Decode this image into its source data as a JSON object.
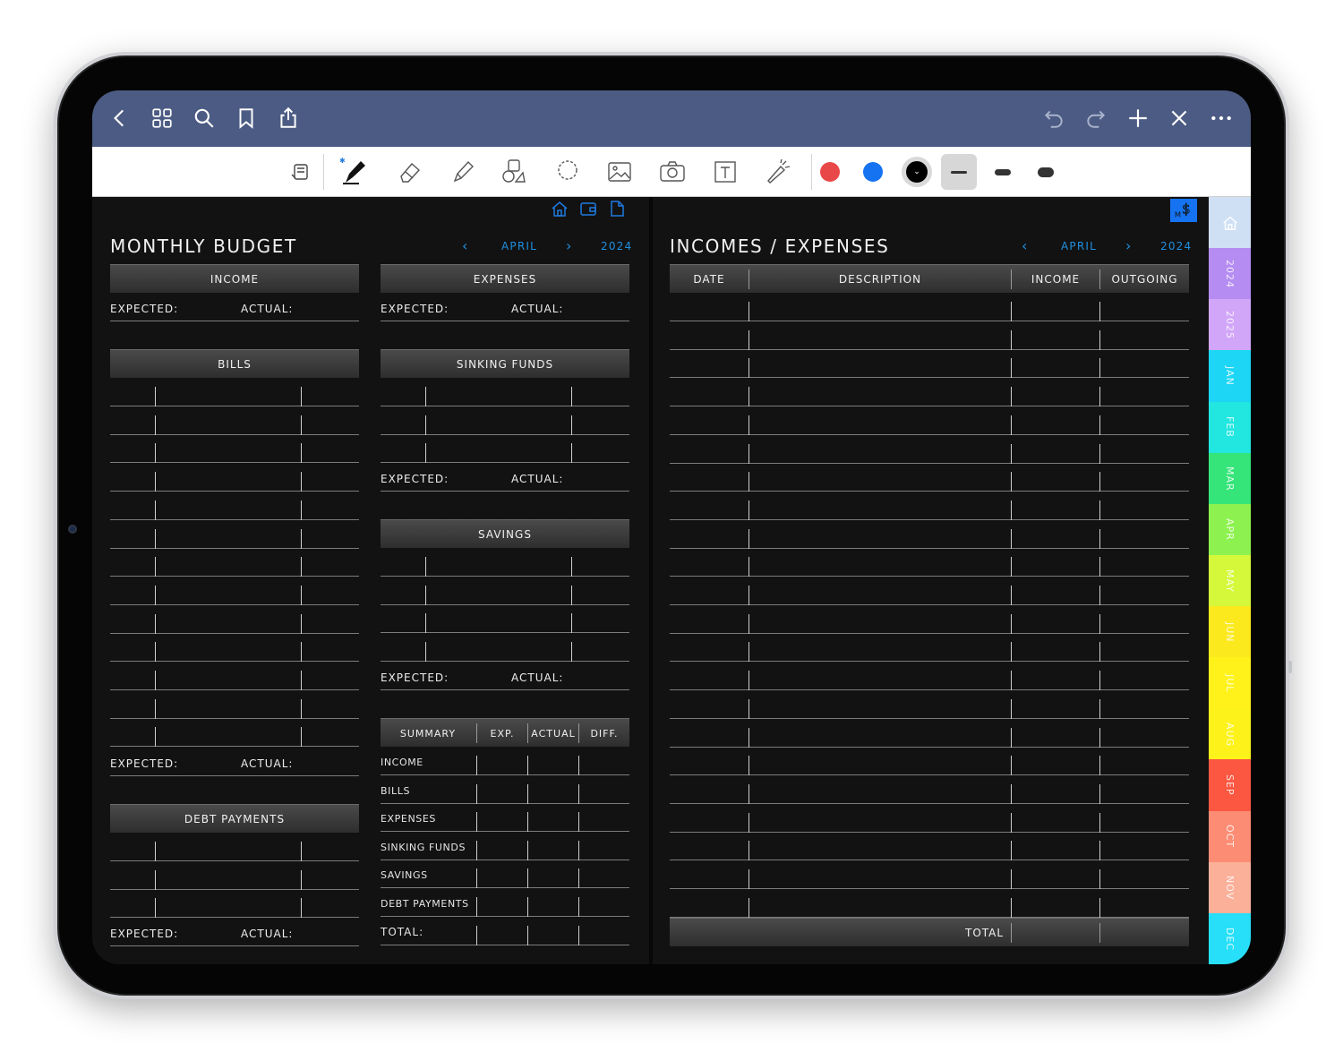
{
  "app": {
    "topbar": {
      "left_icons": [
        "back-chevron-icon",
        "grid-icon",
        "search-icon",
        "bookmark-icon",
        "share-icon"
      ],
      "right_icons": [
        "undo-icon",
        "redo-icon",
        "plus-icon",
        "close-tools-icon",
        "more-icon"
      ]
    },
    "toolbar": {
      "tools": [
        "toolbar-toggle-icon",
        "pen-icon",
        "eraser-icon",
        "highlighter-icon",
        "shapes-icon",
        "lasso-icon",
        "image-icon",
        "camera-icon",
        "text-icon",
        "laser-pointer-icon"
      ],
      "colors": [
        "#e94848",
        "#1573f2",
        "#000000"
      ],
      "stroke_widths": [
        "thin",
        "medium",
        "thick"
      ]
    }
  },
  "left_page": {
    "title": "MONTHLY BUDGET",
    "nav": {
      "prev": "‹",
      "month": "APRIL",
      "next": "›",
      "year": "2024"
    },
    "income": {
      "header": "INCOME",
      "expected": "EXPECTED:",
      "actual": "ACTUAL:"
    },
    "expenses": {
      "header": "EXPENSES",
      "expected": "EXPECTED:",
      "actual": "ACTUAL:"
    },
    "bills": {
      "header": "BILLS",
      "expected": "EXPECTED:",
      "actual": "ACTUAL:"
    },
    "sinking_funds": {
      "header": "SINKING FUNDS",
      "expected": "EXPECTED:",
      "actual": "ACTUAL:"
    },
    "savings": {
      "header": "SAVINGS",
      "expected": "EXPECTED:",
      "actual": "ACTUAL:"
    },
    "debt_payments": {
      "header": "DEBT PAYMENTS",
      "expected": "EXPECTED:",
      "actual": "ACTUAL:"
    },
    "summary": {
      "columns": [
        "SUMMARY",
        "EXP.",
        "ACTUAL",
        "DIFF."
      ],
      "rows": [
        "INCOME",
        "BILLS",
        "EXPENSES",
        "SINKING FUNDS",
        "SAVINGS",
        "DEBT PAYMENTS",
        "TOTAL:"
      ]
    }
  },
  "right_page": {
    "title": "INCOMES / EXPENSES",
    "nav": {
      "prev": "‹",
      "month": "APRIL",
      "next": "›",
      "year": "2024"
    },
    "columns": [
      "DATE",
      "DESCRIPTION",
      "INCOME",
      "OUTGOING"
    ],
    "total_label": "TOTAL"
  },
  "side_tabs": [
    {
      "label": "",
      "icon": "home-icon",
      "color": "#cfe0f5"
    },
    {
      "label": "2024",
      "color": "#b58cf2"
    },
    {
      "label": "2025",
      "color": "#d1a6f8"
    },
    {
      "label": "JAN",
      "color": "#1dd6f5"
    },
    {
      "label": "FEB",
      "color": "#22e6e0"
    },
    {
      "label": "MAR",
      "color": "#36e57a"
    },
    {
      "label": "APR",
      "color": "#8df24f"
    },
    {
      "label": "MAY",
      "color": "#d5f83a"
    },
    {
      "label": "JUN",
      "color": "#fbe91d"
    },
    {
      "label": "JUL",
      "color": "#fff21a"
    },
    {
      "label": "AUG",
      "color": "#fdf21a"
    },
    {
      "label": "SEP",
      "color": "#fb5741"
    },
    {
      "label": "OCT",
      "color": "#fd8c74"
    },
    {
      "label": "NOV",
      "color": "#fbb09a"
    },
    {
      "label": "DEC",
      "color": "#27dff8"
    }
  ]
}
